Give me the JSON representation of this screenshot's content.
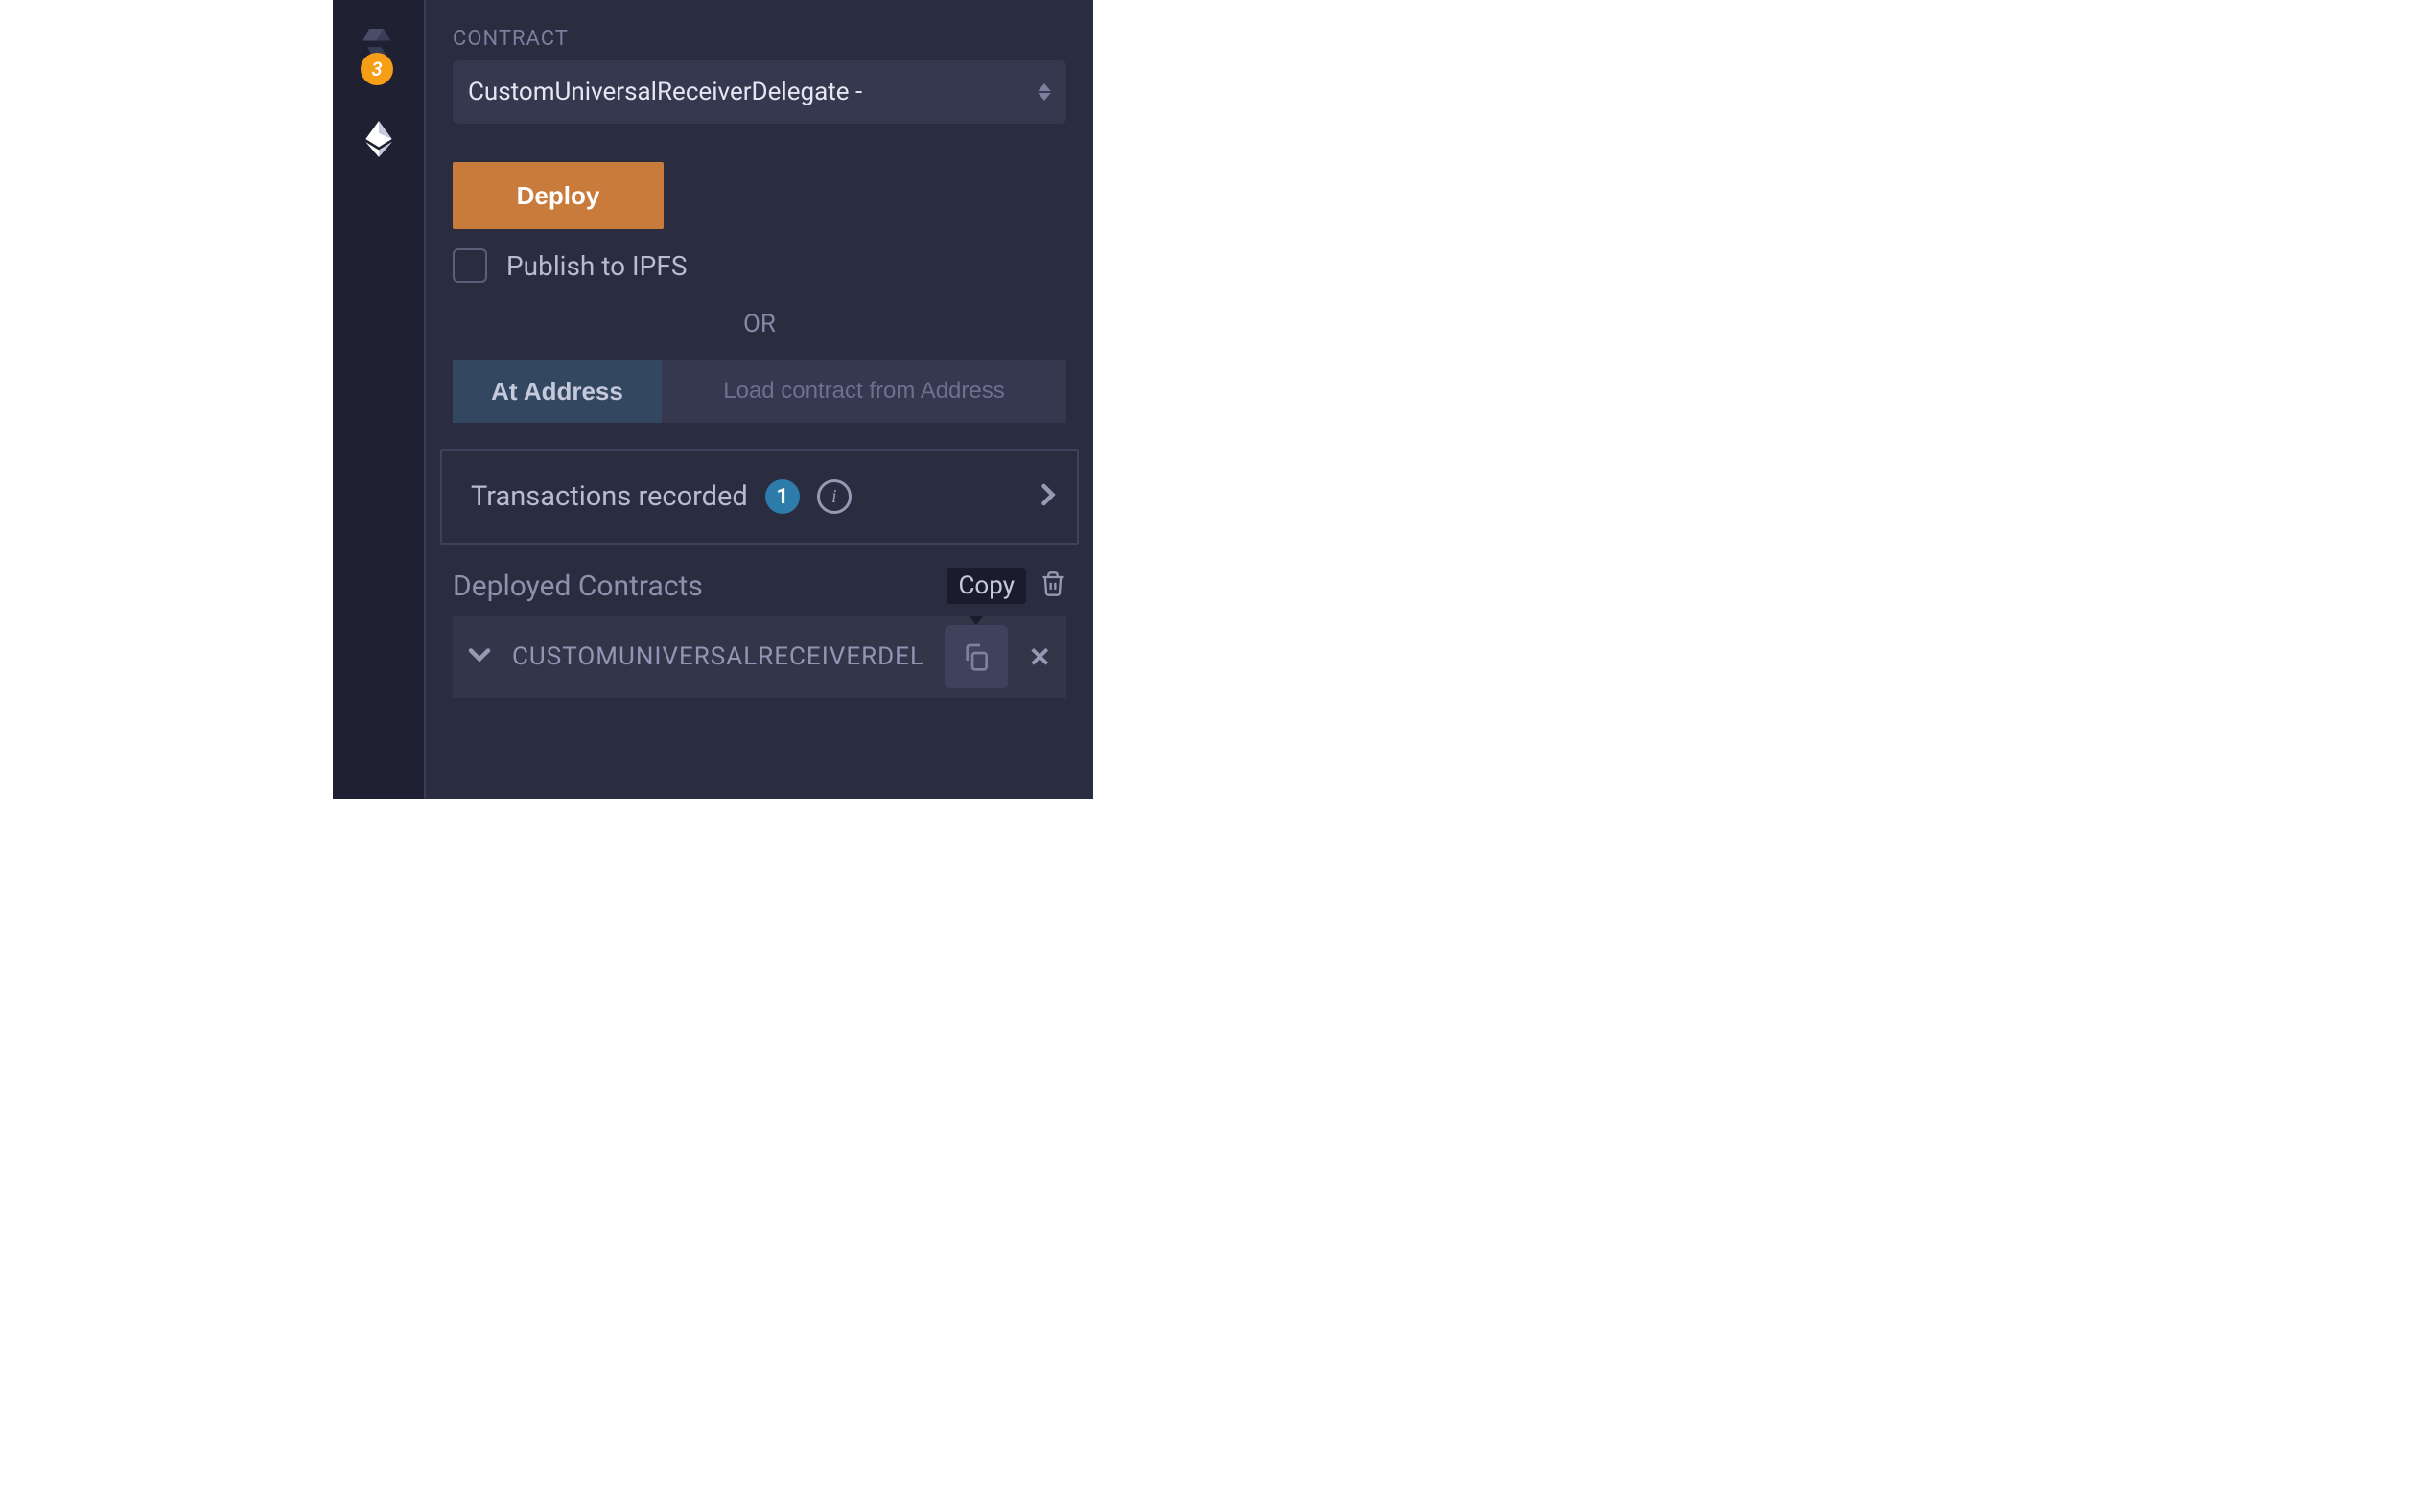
{
  "sidebar": {
    "solidity_badge": "3"
  },
  "contract": {
    "label": "CONTRACT",
    "selected": "CustomUniversalReceiverDelegate -",
    "deploy_label": "Deploy",
    "publish_ipfs_label": "Publish to IPFS",
    "or_label": "OR",
    "at_address_label": "At Address",
    "address_placeholder": "Load contract from Address"
  },
  "transactions": {
    "label": "Transactions recorded",
    "count": "1"
  },
  "deployed": {
    "header": "Deployed Contracts",
    "copy_tooltip": "Copy",
    "items": [
      {
        "name": "CUSTOMUNIVERSALRECEIVERDEL"
      }
    ]
  }
}
